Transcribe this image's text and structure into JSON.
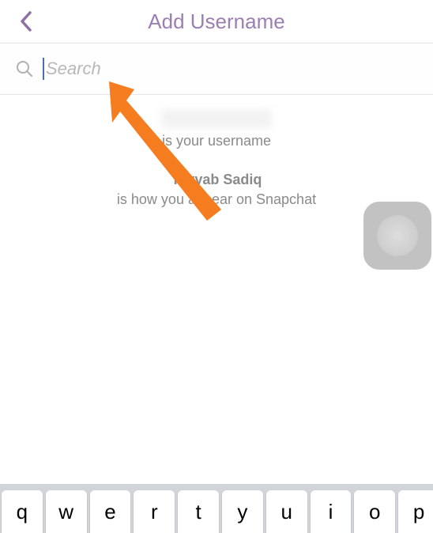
{
  "header": {
    "title": "Add Username"
  },
  "search": {
    "placeholder": "Search",
    "value": ""
  },
  "content": {
    "username_line": "is your username",
    "display_name": "Tayyab Sadiq",
    "appear_line": "is how you appear on Snapchat"
  },
  "keyboard": {
    "row": [
      "q",
      "w",
      "e",
      "r",
      "t",
      "y",
      "u",
      "i",
      "o",
      "p"
    ]
  }
}
